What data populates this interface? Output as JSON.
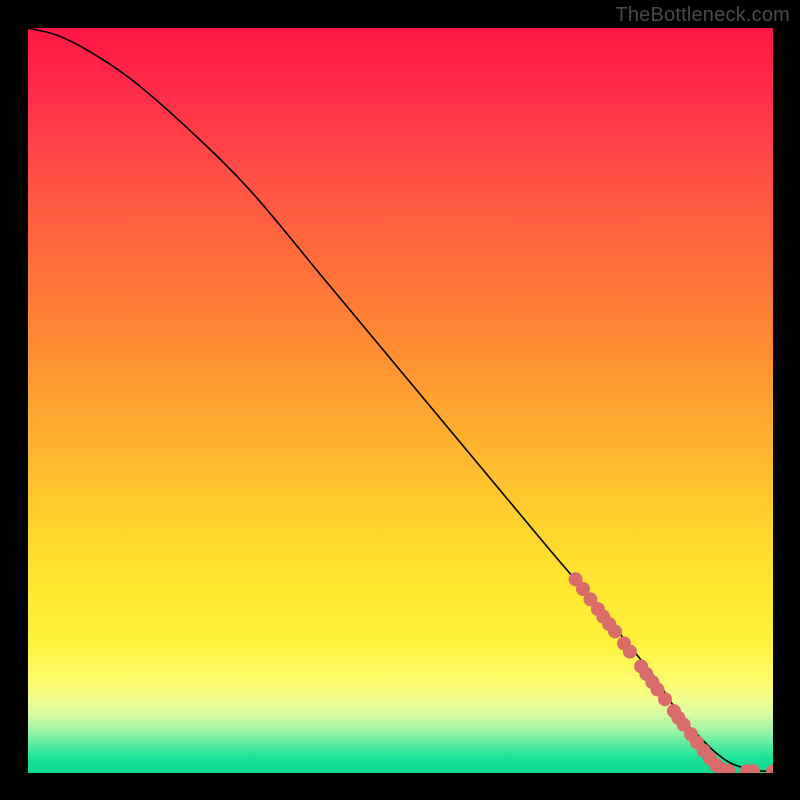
{
  "watermark": "TheBottleneck.com",
  "chart_data": {
    "type": "line",
    "title": "",
    "xlabel": "",
    "ylabel": "",
    "xlim": [
      0,
      100
    ],
    "ylim": [
      0,
      100
    ],
    "grid": false,
    "legend": false,
    "series": [
      {
        "name": "curve",
        "x": [
          0,
          4,
          8,
          14,
          22,
          30,
          40,
          50,
          60,
          70,
          76,
          80,
          84,
          86,
          88,
          90,
          92,
          94,
          96,
          98,
          100
        ],
        "y": [
          100,
          99,
          97,
          93,
          86,
          78,
          66,
          54,
          42,
          30,
          23,
          18,
          13,
          10,
          7,
          5,
          3,
          1.5,
          0.7,
          0.3,
          0.2
        ]
      }
    ],
    "highlight_points": {
      "comment": "Coral dots overlaid on the curve near the right/bottom end",
      "points": [
        {
          "x": 73.5,
          "y": 26
        },
        {
          "x": 74.5,
          "y": 24.7
        },
        {
          "x": 75.5,
          "y": 23.3
        },
        {
          "x": 76.5,
          "y": 22
        },
        {
          "x": 77.2,
          "y": 21
        },
        {
          "x": 78.0,
          "y": 20
        },
        {
          "x": 78.8,
          "y": 19
        },
        {
          "x": 80.0,
          "y": 17.4
        },
        {
          "x": 80.8,
          "y": 16.3
        },
        {
          "x": 82.3,
          "y": 14.3
        },
        {
          "x": 83.0,
          "y": 13.3
        },
        {
          "x": 83.8,
          "y": 12.2
        },
        {
          "x": 84.5,
          "y": 11.2
        },
        {
          "x": 85.5,
          "y": 9.9
        },
        {
          "x": 86.7,
          "y": 8.3
        },
        {
          "x": 87.3,
          "y": 7.4
        },
        {
          "x": 88.0,
          "y": 6.5
        },
        {
          "x": 89.0,
          "y": 5.2
        },
        {
          "x": 89.8,
          "y": 4.1
        },
        {
          "x": 90.7,
          "y": 3.0
        },
        {
          "x": 91.5,
          "y": 2.0
        },
        {
          "x": 92.3,
          "y": 1.1
        },
        {
          "x": 93.0,
          "y": 0.6
        },
        {
          "x": 94.0,
          "y": 0.3
        },
        {
          "x": 96.5,
          "y": 0.25
        },
        {
          "x": 97.3,
          "y": 0.25
        },
        {
          "x": 100.0,
          "y": 0.2
        }
      ]
    },
    "gradient_stops": [
      {
        "pos": 0,
        "color": "#ff1744"
      },
      {
        "pos": 18,
        "color": "#ff4a46"
      },
      {
        "pos": 42,
        "color": "#ff8a33"
      },
      {
        "pos": 66,
        "color": "#ffd12e"
      },
      {
        "pos": 87,
        "color": "#fffb66"
      },
      {
        "pos": 96,
        "color": "#5eeca0"
      },
      {
        "pos": 100,
        "color": "#0fd890"
      }
    ]
  }
}
